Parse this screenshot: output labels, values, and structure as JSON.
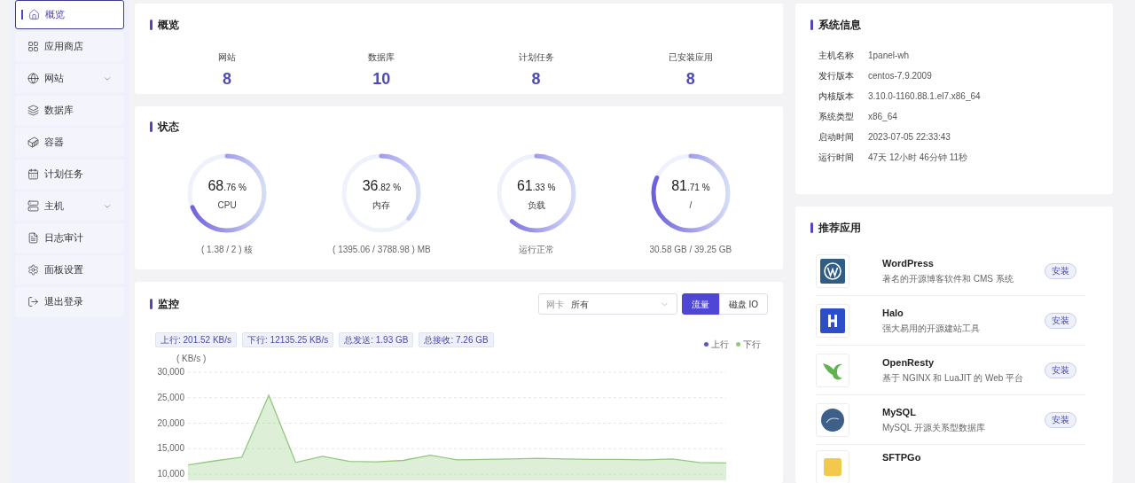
{
  "sidebar": {
    "items": [
      {
        "label": "概览",
        "selected": true,
        "expandable": false
      },
      {
        "label": "应用商店",
        "selected": false,
        "expandable": false
      },
      {
        "label": "网站",
        "selected": false,
        "expandable": true
      },
      {
        "label": "数据库",
        "selected": false,
        "expandable": false
      },
      {
        "label": "容器",
        "selected": false,
        "expandable": false
      },
      {
        "label": "计划任务",
        "selected": false,
        "expandable": false
      },
      {
        "label": "主机",
        "selected": false,
        "expandable": true
      },
      {
        "label": "日志审计",
        "selected": false,
        "expandable": false
      },
      {
        "label": "面板设置",
        "selected": false,
        "expandable": false
      },
      {
        "label": "退出登录",
        "selected": false,
        "expandable": false
      }
    ]
  },
  "overview": {
    "title": "概览",
    "stats": [
      {
        "label": "网站",
        "value": "8"
      },
      {
        "label": "数据库",
        "value": "10"
      },
      {
        "label": "计划任务",
        "value": "8"
      },
      {
        "label": "已安装应用",
        "value": "8"
      }
    ]
  },
  "status": {
    "title": "状态",
    "gauges": [
      {
        "value": "68.76 %",
        "label": "CPU",
        "level": 0.6876,
        "detail": "( 1.38 / 2 ) 核"
      },
      {
        "value": "36.82 %",
        "label": "内存",
        "level": 0.3682,
        "detail": "( 1395.06 / 3788.98 ) MB"
      },
      {
        "value": "61.33 %",
        "label": "负载",
        "level": 0.6133,
        "detail": "运行正常"
      },
      {
        "value": "81.71 %",
        "label": "/",
        "level": 0.8171,
        "detail": "30.58 GB / 39.25 GB"
      }
    ]
  },
  "monitor": {
    "title": "监控",
    "nic_select": {
      "label": "网卡",
      "value": "所有"
    },
    "tabs": [
      {
        "label": "流量",
        "selected": true
      },
      {
        "label": "磁盘 IO",
        "selected": false
      }
    ],
    "tags": [
      "上行: 201.52 KB/s",
      "下行: 12135.25 KB/s",
      "总发送: 1.93 GB",
      "总接收: 7.26 GB"
    ],
    "chart_data": {
      "type": "area",
      "grid": true,
      "ylabel": "( KB/s )",
      "ylim": [
        10000,
        30000
      ],
      "yticks": [
        {
          "value": 10000,
          "label": "10,000"
        },
        {
          "value": 15000,
          "label": "15,000"
        },
        {
          "value": 20000,
          "label": "20,000"
        },
        {
          "value": 25000,
          "label": "25,000"
        },
        {
          "value": 30000,
          "label": "30,000"
        }
      ],
      "series": [
        {
          "name": "上行",
          "color": "#5b57c6",
          "values": [
            null,
            null,
            null,
            null,
            null,
            null,
            null,
            null,
            null,
            null,
            null,
            null,
            null,
            null,
            null,
            null,
            null,
            null,
            null,
            null,
            null
          ]
        },
        {
          "name": "下行",
          "color": "#91c97f",
          "values": [
            11800,
            12600,
            13300,
            25500,
            12300,
            13500,
            12500,
            12400,
            12700,
            13700,
            12800,
            12900,
            13000,
            13100,
            13000,
            12900,
            12900,
            12800,
            13000,
            12300,
            12200
          ]
        }
      ]
    }
  },
  "system_info": {
    "title": "系统信息",
    "rows": [
      {
        "label": "主机名称",
        "value": "1panel-wh"
      },
      {
        "label": "发行版本",
        "value": "centos-7.9.2009"
      },
      {
        "label": "内核版本",
        "value": "3.10.0-1160.88.1.el7.x86_64"
      },
      {
        "label": "系统类型",
        "value": "x86_64"
      },
      {
        "label": "启动时间",
        "value": "2023-07-05 22:33:43"
      },
      {
        "label": "运行时间",
        "value": "47天 12小时 46分钟 11秒"
      }
    ]
  },
  "recommended": {
    "title": "推荐应用",
    "apps": [
      {
        "name": "WordPress",
        "description": "著名的开源博客软件和 CMS 系统",
        "button": "安装"
      },
      {
        "name": "Halo",
        "description": "强大易用的开源建站工具",
        "button": "安装"
      },
      {
        "name": "OpenResty",
        "description": "基于 NGINX 和 LuaJIT 的 Web 平台",
        "button": "安装"
      },
      {
        "name": "MySQL",
        "description": "MySQL 开源关系型数据库",
        "button": "安装"
      },
      {
        "name": "SFTPGo"
      }
    ]
  }
}
